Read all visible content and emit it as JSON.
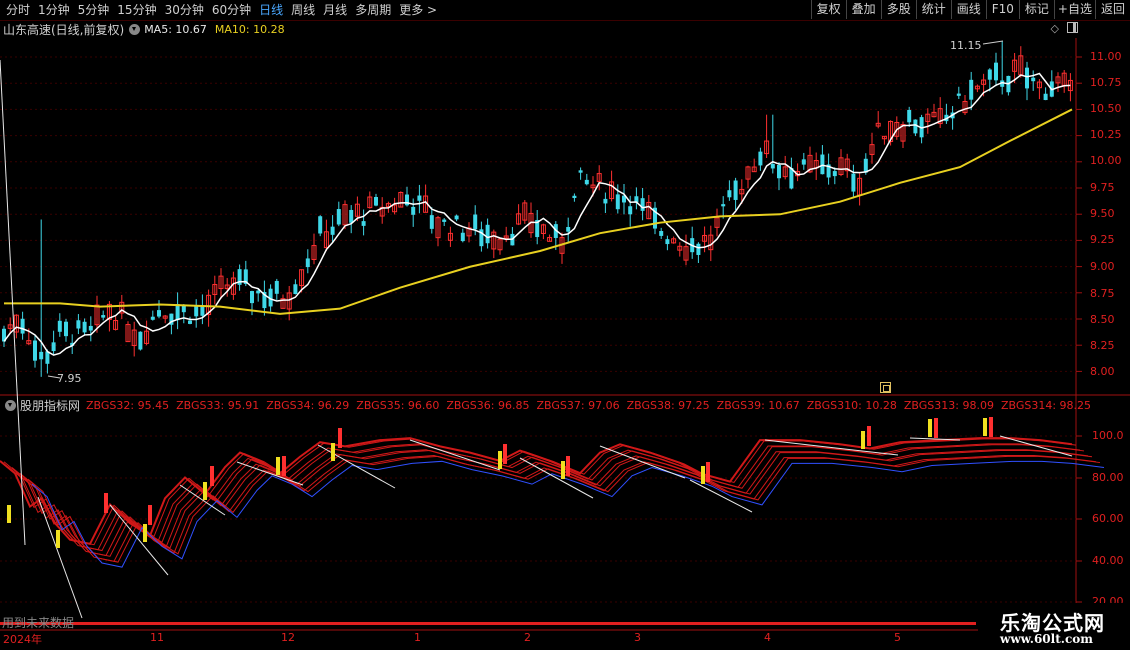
{
  "toolbar": {
    "periods": [
      "分时",
      "1分钟",
      "5分钟",
      "15分钟",
      "30分钟",
      "60分钟",
      "日线",
      "周线",
      "月线",
      "多周期",
      "更多 >"
    ],
    "active_period": "日线",
    "right_buttons": [
      "复权",
      "叠加",
      "多股",
      "统计",
      "画线",
      "F10",
      "标记",
      "+自选",
      "返回"
    ]
  },
  "info": {
    "stock_name": "山东高速(日线,前复权)",
    "ma5": "MA5: 10.67",
    "ma10": "MA10: 10.28"
  },
  "price_axis": [
    "11.00",
    "10.75",
    "10.50",
    "10.25",
    "10.00",
    "9.75",
    "9.50",
    "9.25",
    "9.00",
    "8.75",
    "8.50",
    "8.25",
    "8.00"
  ],
  "annotations": {
    "high": "11.15",
    "low": "7.95"
  },
  "indicator": {
    "name": "股朋指标网",
    "items": [
      "ZBGS32: 95.45",
      "ZBGS33: 95.91",
      "ZBGS34: 96.29",
      "ZBGS35: 96.60",
      "ZBGS36: 96.85",
      "ZBGS37: 97.06",
      "ZBGS38: 97.25",
      "ZBGS39: 10.67",
      "ZBGS310: 10.28",
      "ZBGS313: 98.09",
      "ZBGS314: 98.25"
    ],
    "axis": [
      "100.0",
      "80.00",
      "60.00",
      "40.00",
      "20.00"
    ]
  },
  "future_note": "用到未来数据",
  "date_axis": [
    "2024年",
    "11",
    "12",
    "1",
    "2",
    "3",
    "4",
    "5"
  ],
  "watermark": {
    "title": "乐淘公式网",
    "url": "www.60lt.com"
  },
  "colors": {
    "up": "#ff3030",
    "down": "#3fd8e8",
    "ma5": "#ffffff",
    "ma10": "#e8d020",
    "grid": "#3a0000",
    "axis_text": "#e02020",
    "active": "#4aa8ff"
  }
}
